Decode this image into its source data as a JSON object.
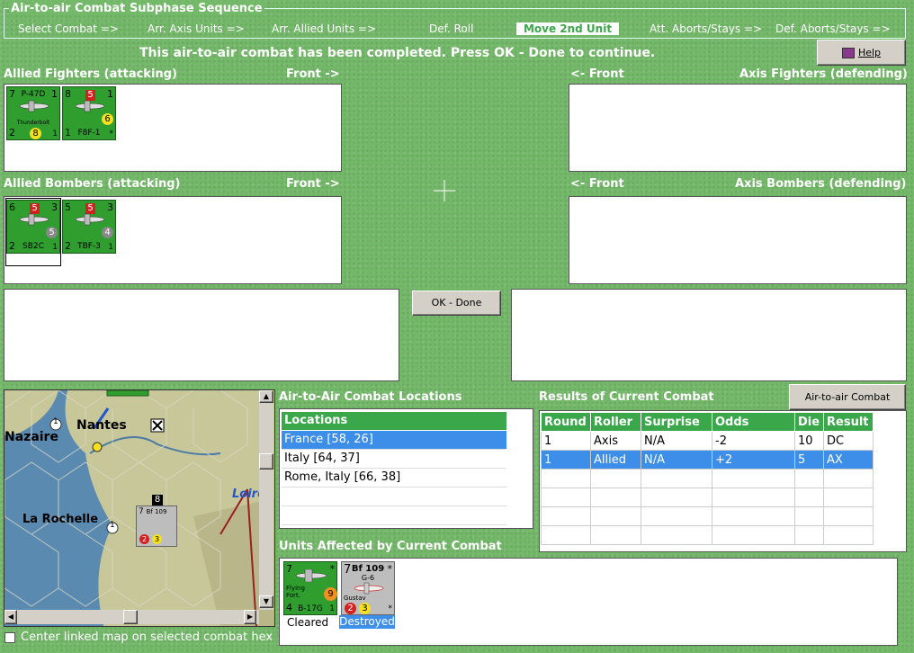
{
  "phase": {
    "title": "Air-to-air Combat Subphase Sequence",
    "steps": [
      {
        "label": "Select Combat =>"
      },
      {
        "label": "Arr. Axis Units =>"
      },
      {
        "label": "Arr. Allied Units =>"
      },
      {
        "label": "Def. Roll"
      },
      {
        "label": "Move 2nd Unit",
        "active": true
      },
      {
        "label": "Att. Aborts/Stays =>"
      },
      {
        "label": "Def. Aborts/Stays =>"
      }
    ]
  },
  "status_message": "This air-to-air combat has been completed.  Press OK - Done to continue.",
  "help_label": "Help",
  "panels": {
    "allied_fighters": {
      "title": "Allied Fighters (attacking)",
      "front": "Front ->"
    },
    "axis_fighters": {
      "title": "Axis Fighters (defending)",
      "front": "<- Front"
    },
    "allied_bombers": {
      "title": "Allied Bombers (attacking)",
      "front": "Front ->"
    },
    "axis_bombers": {
      "title": "Axis Bombers (defending)",
      "front": "<- Front"
    }
  },
  "counters": {
    "p47d": {
      "tl": "7",
      "tr": "1",
      "name": "P-47D",
      "sub": "Thunderbolt",
      "bl": "2",
      "circle": "8",
      "br": "1"
    },
    "f8f1": {
      "tl": "8",
      "red": "5",
      "tr": "1",
      "circle": "6",
      "bl": "1",
      "name": "F8F-1",
      "br": "*"
    },
    "sb2c": {
      "tl": "6",
      "red": "5",
      "tr": "3",
      "circle": "5",
      "bl": "2",
      "name": "SB2C",
      "br": "1"
    },
    "tbf3": {
      "tl": "5",
      "red": "5",
      "tr": "3",
      "circle": "4",
      "bl": "2",
      "name": "TBF-3",
      "br": "1"
    },
    "b17g": {
      "tl": "7",
      "tr": "*",
      "sub": "Flying Fort.",
      "circle": "9",
      "bl": "4",
      "name": "B-17G",
      "br": "1"
    },
    "bf109": {
      "tl": "7",
      "name": "Bf 109",
      "variant": "G-6",
      "tr": "*",
      "sub": "Gustav",
      "red": "2",
      "circle": "3",
      "br": "*"
    }
  },
  "ok_done_label": "OK - Done",
  "locations": {
    "title": "Air-to-Air Combat Locations",
    "header": "Locations",
    "items": [
      "France [58, 26]",
      "Italy [64, 37]",
      "Rome, Italy [66, 38]"
    ],
    "selected_index": 0
  },
  "results": {
    "title": "Results of Current Combat",
    "chart_button": "Air-to-air Combat Chart",
    "columns": [
      "Round",
      "Roller",
      "Surprise",
      "Odds",
      "Die",
      "Result"
    ],
    "rows": [
      [
        "1",
        "Axis",
        "N/A",
        "-2",
        "10",
        "DC"
      ],
      [
        "1",
        "Allied",
        "N/A",
        "+2",
        "5",
        "AX"
      ]
    ],
    "selected_index": 1
  },
  "affected": {
    "title": "Units Affected by Current Combat",
    "units": [
      {
        "label": "Cleared"
      },
      {
        "label": "Destroyed"
      }
    ]
  },
  "map": {
    "cities": [
      "Nantes",
      "Nazaire",
      "La Rochelle",
      "Loire"
    ],
    "hex_number": "1",
    "stack_number": "8",
    "checkbox_label": "Center linked map on selected combat hex",
    "checkbox_checked": false
  },
  "colors": {
    "accent": "#3aa84a",
    "selection": "#3d8ee8",
    "background": "#74b86a"
  }
}
